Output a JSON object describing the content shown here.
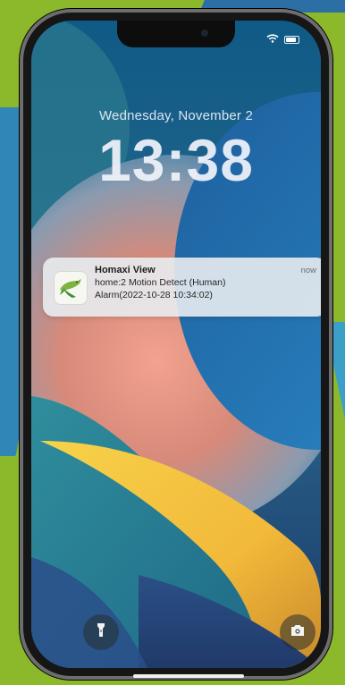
{
  "lock_screen": {
    "date": "Wednesday, November 2",
    "time": "13:38"
  },
  "status_bar": {
    "icons": [
      "wifi-icon",
      "battery-icon"
    ]
  },
  "notification": {
    "app_name": "Homaxi View",
    "message_line1": "home:2 Motion Detect (Human)",
    "message_line2": "Alarm(2022-10-28 10:34:02)",
    "timestamp": "now",
    "icon": "hummingbird-app-icon"
  },
  "quick_actions": {
    "left_icon": "flashlight-icon",
    "right_icon": "camera-icon"
  },
  "colors": {
    "page_background": "#8cb82c",
    "accent_blue": "#2f86b7",
    "notification_bg": "#e8ecf0"
  }
}
